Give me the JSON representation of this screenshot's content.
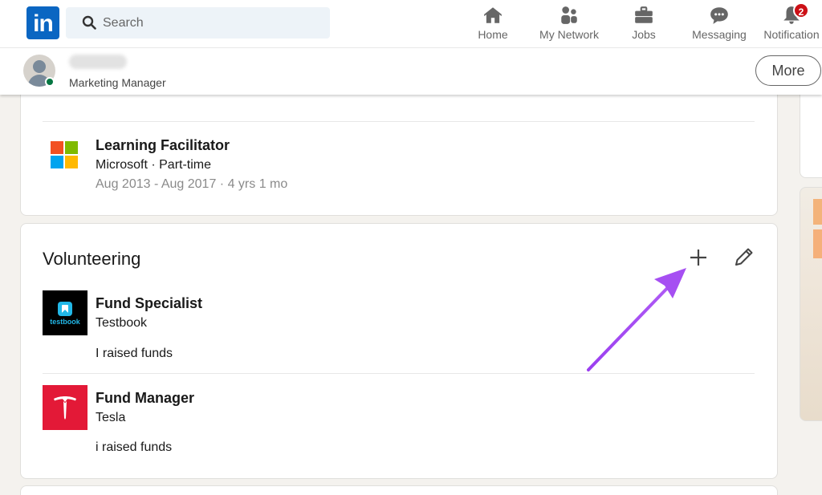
{
  "nav": {
    "search_placeholder": "Search",
    "items": [
      {
        "label": "Home",
        "icon": "home-icon"
      },
      {
        "label": "My Network",
        "icon": "my-network-icon"
      },
      {
        "label": "Jobs",
        "icon": "jobs-icon"
      },
      {
        "label": "Messaging",
        "icon": "messaging-icon"
      },
      {
        "label": "Notification",
        "icon": "bell-icon",
        "badge": "2"
      }
    ],
    "brand_color": "#0a66c2"
  },
  "profile_bar": {
    "headline": "Marketing Manager",
    "more_label": "More"
  },
  "experience": {
    "entries": [
      {
        "title": "Learning Facilitator",
        "company": "Microsoft · Part-time",
        "dates": "Aug 2013 - Aug 2017 · 4 yrs 1 mo",
        "logo": "microsoft-logo"
      }
    ]
  },
  "volunteering": {
    "title": "Volunteering",
    "entries": [
      {
        "role": "Fund Specialist",
        "organization": "Testbook",
        "description": "I raised funds",
        "logo": "testbook-logo",
        "logo_text": "testbook"
      },
      {
        "role": "Fund Manager",
        "organization": "Tesla",
        "description": "i raised funds",
        "logo": "tesla-logo"
      }
    ]
  },
  "annotation": {
    "color": "#a64ff2"
  }
}
